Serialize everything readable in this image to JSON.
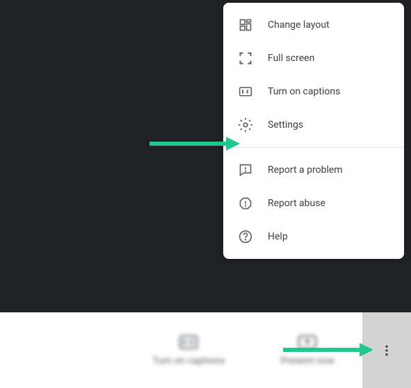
{
  "menu": {
    "section1": [
      {
        "icon": "change-layout-icon",
        "label": "Change layout"
      },
      {
        "icon": "fullscreen-icon",
        "label": "Full screen"
      },
      {
        "icon": "captions-icon",
        "label": "Turn on captions"
      },
      {
        "icon": "settings-icon",
        "label": "Settings"
      }
    ],
    "section2": [
      {
        "icon": "report-problem-icon",
        "label": "Report a problem"
      },
      {
        "icon": "report-abuse-icon",
        "label": "Report abuse"
      },
      {
        "icon": "help-icon",
        "label": "Help"
      }
    ]
  },
  "bottomBar": {
    "captions": "Turn on captions",
    "present": "Present now"
  },
  "colors": {
    "arrow": "#1ec98b"
  }
}
